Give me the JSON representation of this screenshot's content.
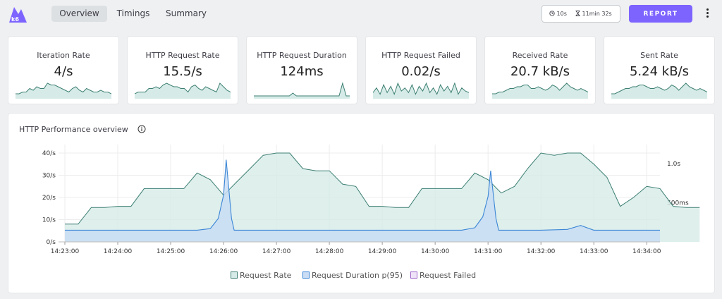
{
  "nav": {
    "tabs": [
      {
        "label": "Overview",
        "active": true
      },
      {
        "label": "Timings",
        "active": false
      },
      {
        "label": "Summary",
        "active": false
      }
    ]
  },
  "toolbar": {
    "period": "10s",
    "elapsed": "11min 32s",
    "report_label": "REPORT",
    "more_icon": "kebab-menu-icon"
  },
  "colors": {
    "accent": "#7d64ff",
    "rate_line": "#3d7f73",
    "rate_fill": "#d6ebe7",
    "duration_line": "#3b86d6",
    "duration_fill": "#c9ddf4",
    "failed_line": "#9d63c7"
  },
  "stats": [
    {
      "label": "Iteration Rate",
      "value": "4/s",
      "spark": [
        2,
        2,
        3,
        3,
        5,
        4,
        6,
        5,
        5,
        8,
        7,
        7,
        6,
        5,
        4,
        3,
        5,
        6,
        4,
        3,
        5,
        4,
        3,
        3,
        4,
        3,
        3,
        2
      ]
    },
    {
      "label": "HTTP Request Rate",
      "value": "15.5/s",
      "spark": [
        2,
        3,
        3,
        3,
        5,
        5,
        6,
        5,
        7,
        8,
        7,
        6,
        6,
        5,
        5,
        3,
        6,
        7,
        5,
        4,
        6,
        5,
        4,
        3,
        8,
        6,
        4,
        3
      ]
    },
    {
      "label": "HTTP Request Duration",
      "value": "124ms",
      "spark": [
        1,
        1,
        1,
        1,
        1,
        1,
        1,
        1,
        1,
        1,
        1,
        3,
        1,
        1,
        1,
        1,
        1,
        1,
        1,
        1,
        1,
        1,
        1,
        1,
        1,
        10,
        1,
        1
      ]
    },
    {
      "label": "HTTP Request Failed",
      "value": "0.02/s",
      "spark": [
        3,
        6,
        2,
        8,
        3,
        7,
        2,
        9,
        4,
        6,
        3,
        8,
        2,
        7,
        4,
        9,
        3,
        6,
        2,
        8,
        4,
        7,
        3,
        9,
        2,
        6,
        4,
        3
      ]
    },
    {
      "label": "Received Rate",
      "value": "20.7 kB/s",
      "spark": [
        2,
        2,
        3,
        3,
        4,
        5,
        5,
        6,
        6,
        7,
        7,
        5,
        5,
        6,
        5,
        4,
        5,
        7,
        6,
        4,
        6,
        8,
        6,
        5,
        4,
        5,
        4,
        3
      ]
    },
    {
      "label": "Sent Rate",
      "value": "5.24 kB/s",
      "spark": [
        2,
        2,
        3,
        4,
        5,
        5,
        6,
        6,
        7,
        7,
        6,
        5,
        5,
        6,
        5,
        4,
        5,
        7,
        6,
        4,
        6,
        8,
        6,
        5,
        4,
        5,
        4,
        3
      ]
    }
  ],
  "chart": {
    "title": "HTTP Performance overview",
    "legend": [
      "Request Rate",
      "Request Duration p(95)",
      "Request Failed"
    ]
  },
  "chart_data": {
    "type": "line",
    "x_ticks": [
      "14:23:00",
      "14:24:00",
      "14:25:00",
      "14:26:00",
      "14:27:00",
      "14:28:00",
      "14:29:00",
      "14:30:00",
      "14:31:00",
      "14:32:00",
      "14:33:00",
      "14:34:00"
    ],
    "y_left_ticks": [
      "0/s",
      "10/s",
      "20/s",
      "30/s",
      "40/s"
    ],
    "y_left_range": [
      0,
      40
    ],
    "y_right_ticks": [
      "500ms",
      "1.0s"
    ],
    "y_right_range_ms": [
      0,
      1250
    ],
    "series": [
      {
        "name": "Request Rate",
        "axis": "left",
        "t": [
          0,
          0.25,
          0.5,
          0.75,
          1,
          1.25,
          1.5,
          1.75,
          2,
          2.25,
          2.5,
          2.75,
          3,
          3.25,
          3.5,
          3.75,
          4,
          4.25,
          4.5,
          4.75,
          5,
          5.25,
          5.5,
          5.75,
          6,
          6.25,
          6.5,
          6.75,
          7,
          7.25,
          7.5,
          7.75,
          8,
          8.25,
          8.5,
          8.75,
          9,
          9.25,
          9.5,
          9.75,
          10,
          10.25,
          10.5,
          10.75,
          11,
          11.25
        ],
        "values": [
          8,
          8,
          15.5,
          15.5,
          16,
          16,
          24,
          24,
          24,
          24,
          31,
          28,
          21,
          27,
          33,
          39,
          40,
          40,
          33,
          32,
          32,
          26,
          25,
          16,
          16,
          15.5,
          15.5,
          24,
          24,
          24,
          24,
          31,
          28,
          22,
          25,
          33,
          40,
          39,
          40,
          40,
          35,
          29,
          16,
          20,
          25,
          24,
          16,
          15.5,
          15.5
        ]
      },
      {
        "name": "Request Duration p(95)",
        "axis": "right",
        "t": [
          0,
          2.5,
          2.75,
          2.9,
          3.0,
          3.05,
          3.15,
          3.2,
          3.3,
          4,
          5,
          6,
          7,
          7.5,
          7.75,
          7.9,
          8.0,
          8.05,
          8.15,
          8.2,
          8.3,
          9,
          9.5,
          9.75,
          10,
          10.5,
          11,
          11.25
        ],
        "values_ms": [
          150,
          150,
          170,
          300,
          600,
          1050,
          300,
          150,
          150,
          150,
          150,
          150,
          150,
          150,
          180,
          320,
          580,
          910,
          300,
          150,
          150,
          150,
          160,
          210,
          150,
          150,
          150,
          150
        ]
      },
      {
        "name": "Request Failed",
        "axis": "left",
        "t": [
          0,
          11.25
        ],
        "values": [
          0,
          0
        ]
      }
    ]
  }
}
